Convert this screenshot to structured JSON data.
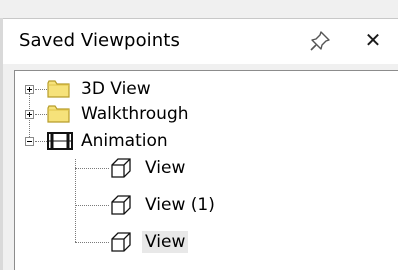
{
  "panel": {
    "title": "Saved Viewpoints",
    "close_glyph": "✕"
  },
  "tree": {
    "items": [
      {
        "label": "3D View",
        "icon": "folder-icon",
        "expander": "plus"
      },
      {
        "label": "Walkthrough",
        "icon": "folder-icon",
        "expander": "plus"
      },
      {
        "label": "Animation",
        "icon": "film-strip-icon",
        "expander": "minus",
        "children": [
          {
            "label": "View",
            "icon": "viewpoint-cube-icon"
          },
          {
            "label": "View (1)",
            "icon": "viewpoint-cube-icon"
          },
          {
            "label": "View",
            "icon": "viewpoint-cube-icon",
            "selected": true
          }
        ]
      }
    ]
  },
  "colors": {
    "folder_fill": "#f6e27a",
    "folder_stroke": "#b79d2a",
    "tree_background": "#ffffff",
    "selection": "#e8e8e8"
  }
}
